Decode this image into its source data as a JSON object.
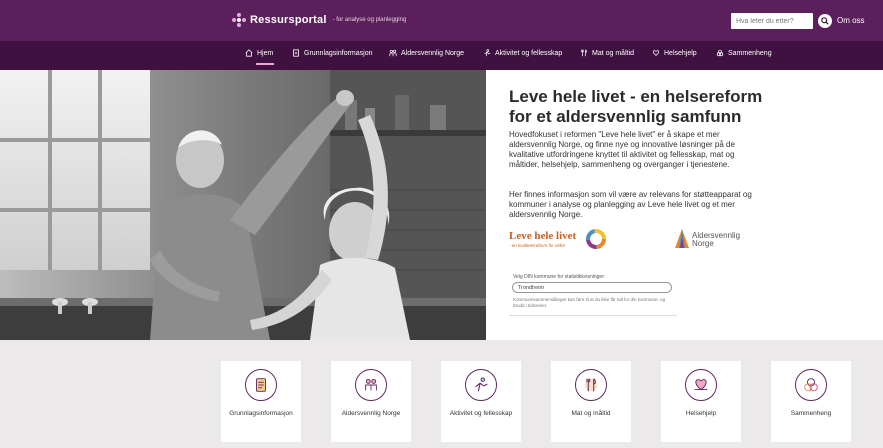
{
  "header": {
    "logo_title": "Ressursportal",
    "logo_sub": "- for analyse og planlegging",
    "search_placeholder": "Hva leter du etter?",
    "about_label": "Om oss"
  },
  "nav": {
    "items": [
      {
        "label": "Hjem",
        "icon": "home-icon",
        "active": true
      },
      {
        "label": "Grunnlagsinformasjon",
        "icon": "document-icon"
      },
      {
        "label": "Aldersvennlig Norge",
        "icon": "people-icon"
      },
      {
        "label": "Aktivitet og fellesskap",
        "icon": "activity-icon"
      },
      {
        "label": "Mat og måltid",
        "icon": "cutlery-icon"
      },
      {
        "label": "Helsehjelp",
        "icon": "health-icon"
      },
      {
        "label": "Sammenheng",
        "icon": "connect-icon"
      }
    ],
    "active_color": "#f3a6c8"
  },
  "hero": {
    "title": "Leve hele livet - en helsereform for et aldersvennlig samfunn",
    "paragraph1": "Hovedfokuset i reformen \"Leve hele livet\" er å skape et mer aldersvennlig Norge, og finne nye og innovative løsninger på de kvalitative utfordringene knyttet til aktivitet og fellesskap, mat og måltider, helsehjelp, sammenheng og overganger i tjenestene.",
    "paragraph2": "Her finnes informasjon som vil være av relevans for støtteapparat og kommuner i analyse og planlegging av Leve hele livet og et mer aldersvennlig Norge.",
    "lhl_logo_text": "Leve hele livet",
    "lhl_logo_sub": "- en kvalitetsreform for eldre",
    "aln_logo_text_1": "Aldersvennlig",
    "aln_logo_text_2": "Norge"
  },
  "kommune": {
    "label": "Velg DIN kommune for statistikkvisninger:",
    "value": "Trondheim",
    "note": "Kommunesammenslåinger kan føre til at du ikke får tall for din kommune, og brudd i tidsserier"
  },
  "cards": [
    {
      "label": "Grunnlagsinformasjon",
      "icon": "document-icon"
    },
    {
      "label": "Aldersvennlig Norge",
      "icon": "people-icon"
    },
    {
      "label": "Aktivitet og fellesskap",
      "icon": "activity-icon"
    },
    {
      "label": "Mat og måltid",
      "icon": "cutlery-icon"
    },
    {
      "label": "Helsehjelp",
      "icon": "health-icon"
    },
    {
      "label": "Sammenheng",
      "icon": "connect-icon"
    }
  ],
  "colors": {
    "topbar": "#5b1f5b",
    "navbar": "#3f1140",
    "card_bg": "#ebe9ea",
    "accent_orange": "#c86020"
  }
}
